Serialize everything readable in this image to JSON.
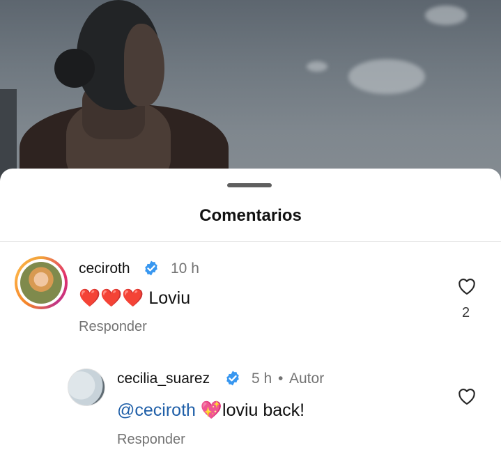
{
  "sheet": {
    "title": "Comentarios"
  },
  "comments": [
    {
      "username": "ceciroth",
      "verified": true,
      "time": "10 h",
      "emojis": "❤️❤️❤️",
      "text": "Loviu",
      "reply_label": "Responder",
      "likes": "2"
    }
  ],
  "replies": [
    {
      "username": "cecilia_suarez",
      "verified": true,
      "time": "5 h",
      "separator": "•",
      "author_label": "Autor",
      "mention": "@ceciroth",
      "emoji": "💖",
      "text": "loviu back!",
      "reply_label": "Responder"
    }
  ],
  "colors": {
    "accent": "#1f5fa8",
    "verified": "#3897f0",
    "muted": "#737373"
  }
}
